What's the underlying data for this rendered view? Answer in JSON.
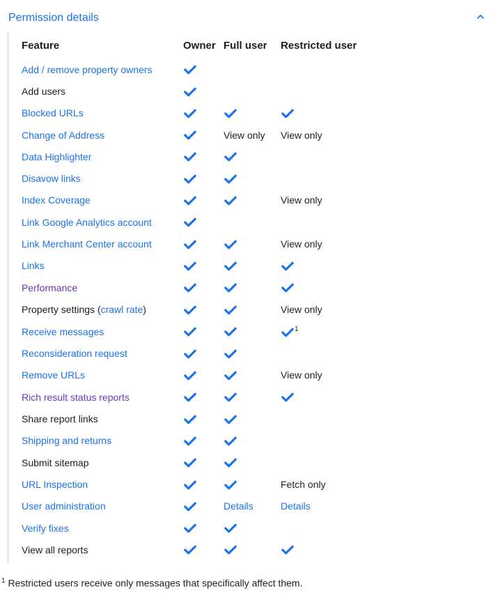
{
  "header": {
    "title": "Permission details"
  },
  "table": {
    "columns": [
      "Feature",
      "Owner",
      "Full user",
      "Restricted user"
    ],
    "rows": [
      {
        "feature": "Add / remove property owners",
        "link": true,
        "owner": "check",
        "full": "",
        "restricted": ""
      },
      {
        "feature": "Add users",
        "link": false,
        "owner": "check",
        "full": "",
        "restricted": ""
      },
      {
        "feature": "Blocked URLs",
        "link": true,
        "owner": "check",
        "full": "check",
        "restricted": "check"
      },
      {
        "feature": "Change of Address",
        "link": true,
        "owner": "check",
        "full": "View only",
        "restricted": "View only"
      },
      {
        "feature": "Data Highlighter",
        "link": true,
        "owner": "check",
        "full": "check",
        "restricted": ""
      },
      {
        "feature": "Disavow links",
        "link": true,
        "owner": "check",
        "full": "check",
        "restricted": ""
      },
      {
        "feature": "Index Coverage",
        "link": true,
        "owner": "check",
        "full": "check",
        "restricted": "View only"
      },
      {
        "feature": "Link Google Analytics account",
        "link": true,
        "owner": "check",
        "full": "",
        "restricted": ""
      },
      {
        "feature": "Link Merchant Center account",
        "link": true,
        "owner": "check",
        "full": "check",
        "restricted": "View only"
      },
      {
        "feature": "Links",
        "link": true,
        "owner": "check",
        "full": "check",
        "restricted": "check"
      },
      {
        "feature": "Performance",
        "link": true,
        "purple": true,
        "owner": "check",
        "full": "check",
        "restricted": "check"
      },
      {
        "feature_prefix": "Property settings (",
        "feature_link": "crawl rate",
        "feature_suffix": ")",
        "mixed": true,
        "owner": "check",
        "full": "check",
        "restricted": "View only"
      },
      {
        "feature": "Receive messages",
        "link": true,
        "owner": "check",
        "full": "check",
        "restricted": "check",
        "restricted_sup": "1"
      },
      {
        "feature": "Reconsideration request",
        "link": true,
        "owner": "check",
        "full": "check",
        "restricted": ""
      },
      {
        "feature": "Remove URLs",
        "link": true,
        "owner": "check",
        "full": "check",
        "restricted": "View only"
      },
      {
        "feature": "Rich result status reports",
        "link": true,
        "purple": true,
        "owner": "check",
        "full": "check",
        "restricted": "check"
      },
      {
        "feature": "Share report links",
        "link": false,
        "owner": "check",
        "full": "check",
        "restricted": ""
      },
      {
        "feature": "Shipping and returns",
        "link": true,
        "owner": "check",
        "full": "check",
        "restricted": ""
      },
      {
        "feature": "Submit sitemap",
        "link": false,
        "owner": "check",
        "full": "check",
        "restricted": ""
      },
      {
        "feature": "URL Inspection",
        "link": true,
        "owner": "check",
        "full": "check",
        "restricted": "Fetch only"
      },
      {
        "feature": "User administration",
        "link": true,
        "owner": "check",
        "full": "Details",
        "full_link": true,
        "restricted": "Details",
        "restricted_link": true
      },
      {
        "feature": "Verify fixes",
        "link": true,
        "owner": "check",
        "full": "check",
        "restricted": ""
      },
      {
        "feature": "View all reports",
        "link": false,
        "owner": "check",
        "full": "check",
        "restricted": "check"
      }
    ]
  },
  "footnote": {
    "marker": "1",
    "text": " Restricted users receive only messages that specifically affect them."
  }
}
